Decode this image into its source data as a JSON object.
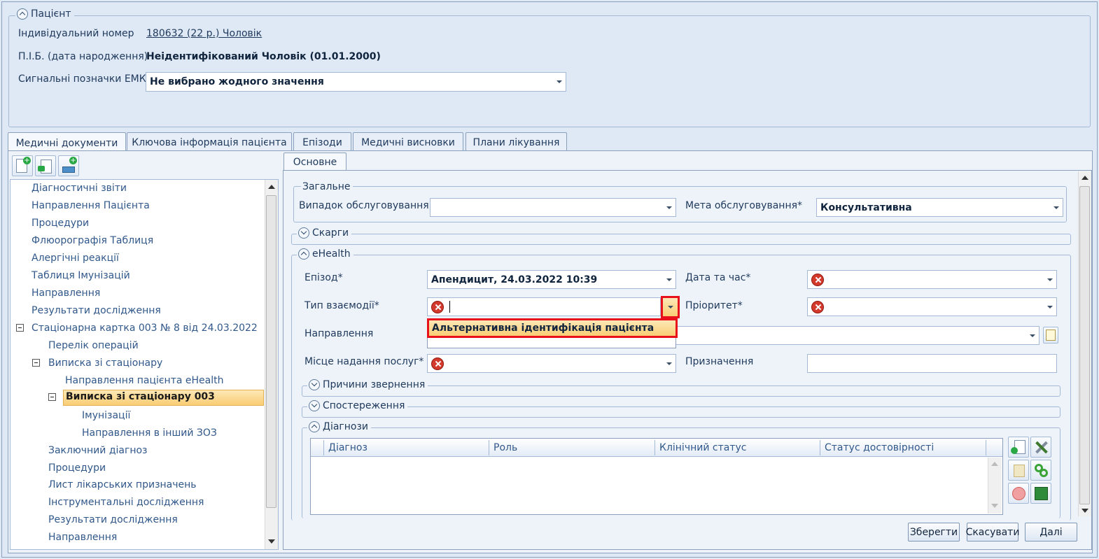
{
  "patient": {
    "legend": "Пацієнт",
    "id_label": "Індивідуальний номер",
    "id_value": "180632 (22 р.) Чоловік",
    "name_label": "П.І.Б. (дата народження)",
    "name_value": "Неідентифікований Чоловік (01.01.2000)",
    "flags_label": "Сигнальні позначки ЕМК",
    "flags_value": "Не вибрано жодного значення"
  },
  "main_tabs": [
    "Медичні документи",
    "Ключова інформація пацієнта",
    "Епізоди",
    "Медичні висновки",
    "Плани лікування"
  ],
  "tree": {
    "items": [
      "Діагностичні звіти",
      "Направлення Пацієнта",
      "Процедури",
      "Флюорографія Таблиця",
      "Алергічні реакції",
      "Таблиця Імунізацій",
      "Направлення",
      "Результати дослідження",
      "Стаціонарна картка 003 № 8 від 24.03.2022",
      "Перелік операцій",
      "Виписка зі стаціонару",
      "Направлення пацієнта eHealth",
      "Виписка зі стаціонару 003",
      "Імунізації",
      "Направлення в інший ЗОЗ",
      "Заключний діагноз",
      "Процедури",
      "Лист лікарських призначень",
      "Інструментальні дослідження",
      "Результати дослідження",
      "Направлення"
    ]
  },
  "form": {
    "inner_tab": "Основне",
    "general": {
      "legend": "Загальне",
      "case_label": "Випадок обслуговування",
      "case_value": "",
      "goal_label": "Мета обслуговування*",
      "goal_value": "Консультативна"
    },
    "complaints_legend": "Скарги",
    "ehealth": {
      "legend": "eHealth",
      "episode_label": "Епізод*",
      "episode_value": "Апендицит, 24.03.2022 10:39",
      "datetime_label": "Дата та час*",
      "interaction_label": "Тип взаємодії*",
      "priority_label": "Пріоритет*",
      "referral_label": "Направлення",
      "place_label": "Місце надання послуг*",
      "purpose_label": "Призначення",
      "dropdown_option": "Альтернативна ідентифікація пацієнта"
    },
    "reasons_legend": "Причини звернення",
    "observations_legend": "Спостереження",
    "diagnoses": {
      "legend": "Діагнози",
      "columns": [
        "Діагноз",
        "Роль",
        "Клінічний статус",
        "Статус достовірності"
      ]
    }
  },
  "buttons": {
    "save": "Зберегти",
    "cancel": "Скасувати",
    "next": "Далі"
  },
  "colors": {
    "highlight_red": "#e8101a",
    "selection_orange": "#f9cd74"
  }
}
